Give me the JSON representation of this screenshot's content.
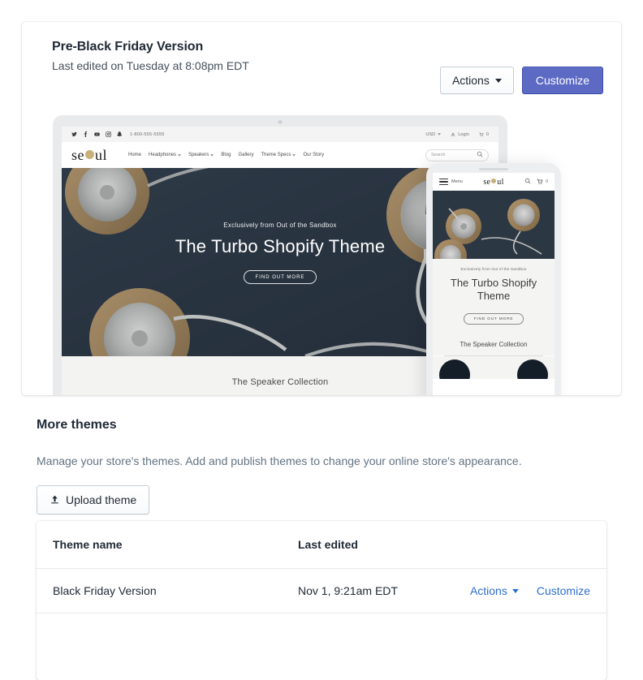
{
  "current_theme": {
    "title": "Pre-Black Friday Version",
    "subtitle": "Last edited on Tuesday at 8:08pm EDT",
    "actions_label": "Actions",
    "customize_label": "Customize"
  },
  "preview": {
    "store": {
      "phone": "1-800-555-5555",
      "currency": "USD",
      "login": "Login",
      "cart_count": "0",
      "logo_part1": "se",
      "logo_part2": "ul",
      "search_placeholder": "Search",
      "nav": [
        {
          "label": "Home",
          "has_caret": false
        },
        {
          "label": "Headphones",
          "has_caret": true
        },
        {
          "label": "Speakers",
          "has_caret": true
        },
        {
          "label": "Blog",
          "has_caret": false
        },
        {
          "label": "Gallery",
          "has_caret": false
        },
        {
          "label": "Theme Specs",
          "has_caret": true
        },
        {
          "label": "Our Story",
          "has_caret": false
        }
      ],
      "hero_kicker": "Exclusively from Out of the Sandbox",
      "hero_title": "The Turbo Shopify Theme",
      "hero_button": "FIND OUT MORE",
      "collection_title": "The Speaker Collection"
    },
    "mobile": {
      "menu_label": "Menu",
      "logo_part1": "se",
      "logo_part2": "ul",
      "cart_count": "0",
      "hero_kicker": "Exclusively from Out of the Sandbox",
      "hero_title": "The Turbo Shopify Theme",
      "hero_button": "FIND OUT MORE",
      "collection_title": "The Speaker Collection"
    },
    "colors": {
      "hero_background": "#2e3a47",
      "logo_accent": "#c8b07a",
      "strip_background": "#f3f3f2"
    }
  },
  "more_themes": {
    "heading": "More themes",
    "description": "Manage your store's themes. Add and publish themes to change your online store's appearance.",
    "upload_label": "Upload theme"
  },
  "themes_table": {
    "columns": {
      "name": "Theme name",
      "last_edited": "Last edited"
    },
    "rows": [
      {
        "name": "Black Friday Version",
        "last_edited": "Nov 1, 9:21am EDT",
        "actions_label": "Actions",
        "customize_label": "Customize"
      }
    ]
  },
  "colors": {
    "primary_button": "#5c6ac4",
    "link": "#2f6ecf",
    "text": "#212b36",
    "muted_text": "#637381"
  }
}
